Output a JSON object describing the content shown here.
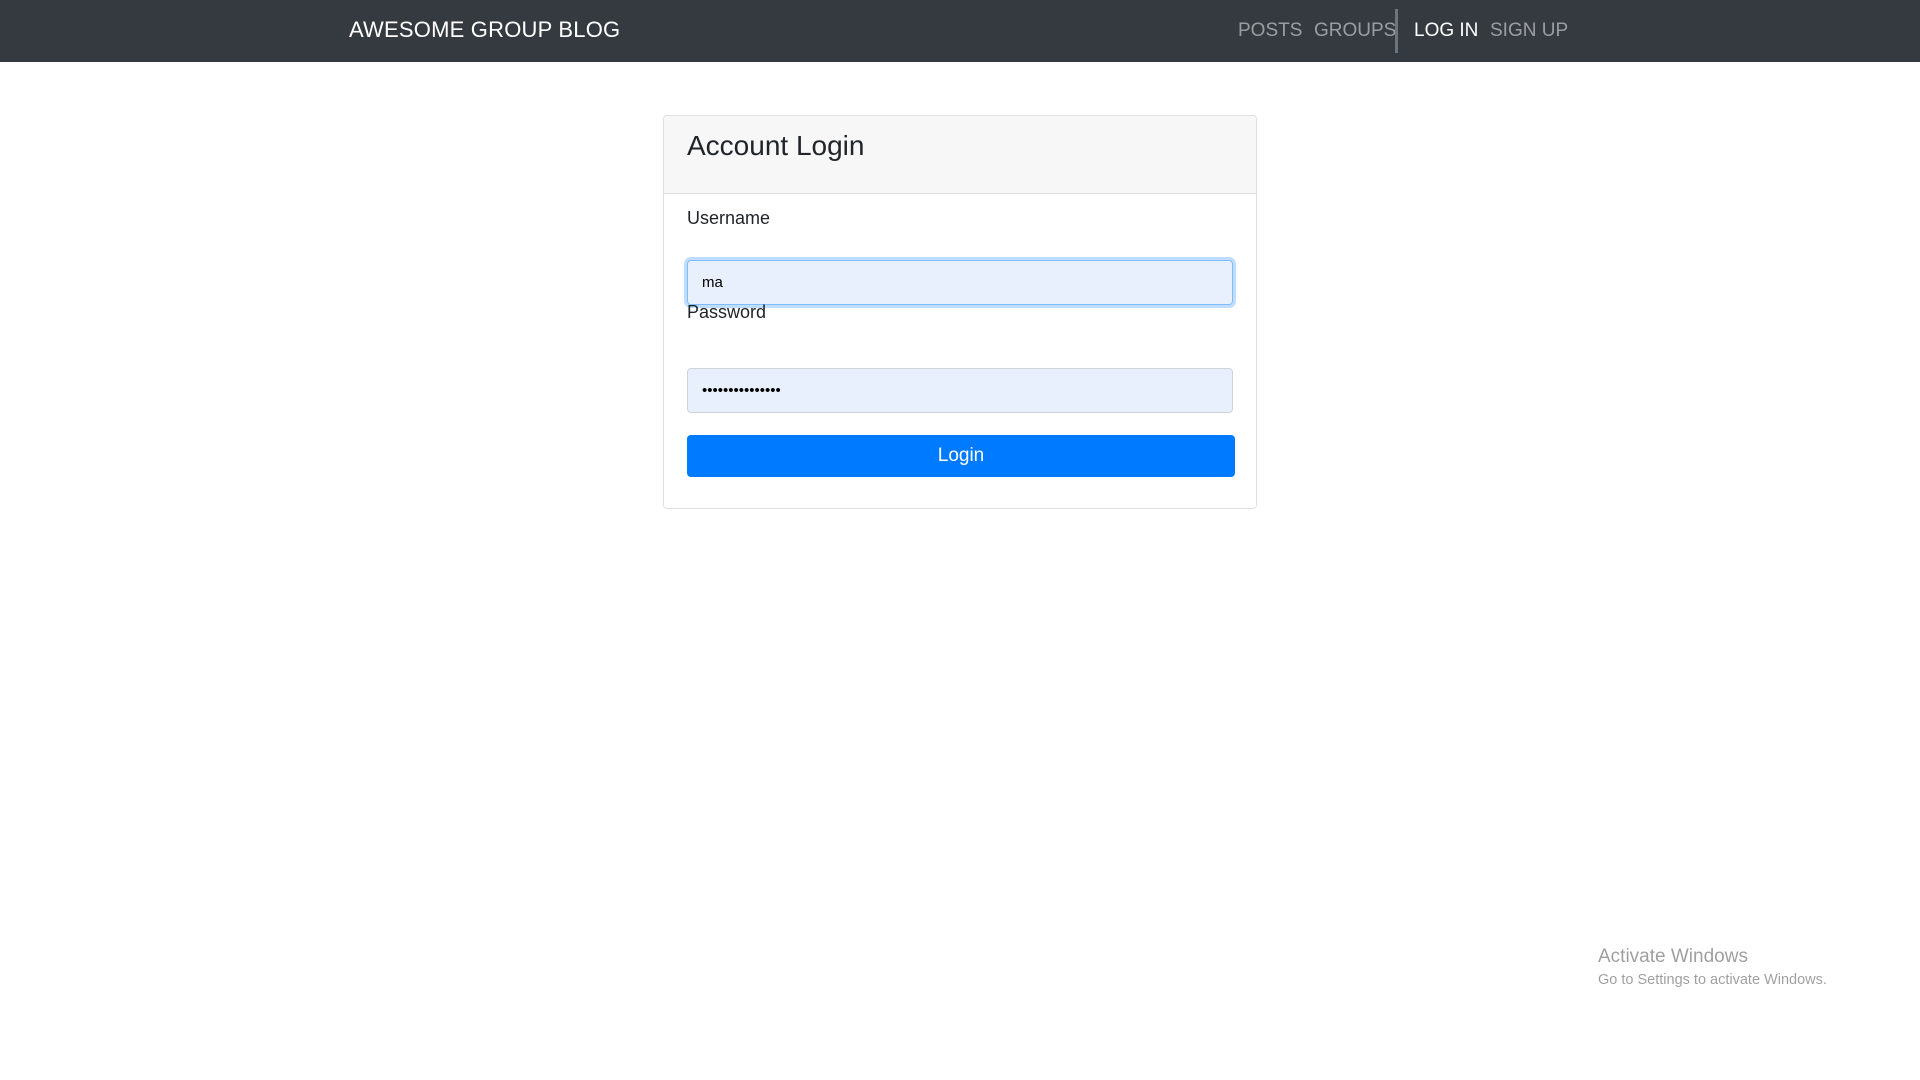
{
  "navbar": {
    "brand": "AWESOME GROUP BLOG",
    "links": [
      {
        "label": "POSTS"
      },
      {
        "label": "GROUPS"
      },
      {
        "label": "LOG IN"
      },
      {
        "label": "SIGN UP"
      }
    ]
  },
  "login_card": {
    "title": "Account Login",
    "username_label": "Username",
    "username_value": "ma",
    "password_label": "Password",
    "password_value": "•••••••••••••••",
    "submit_label": "Login"
  },
  "watermark": {
    "title": "Activate Windows",
    "subtitle": "Go to Settings to activate Windows."
  },
  "colors": {
    "navbar": "#343a40",
    "primary": "#007bff"
  }
}
